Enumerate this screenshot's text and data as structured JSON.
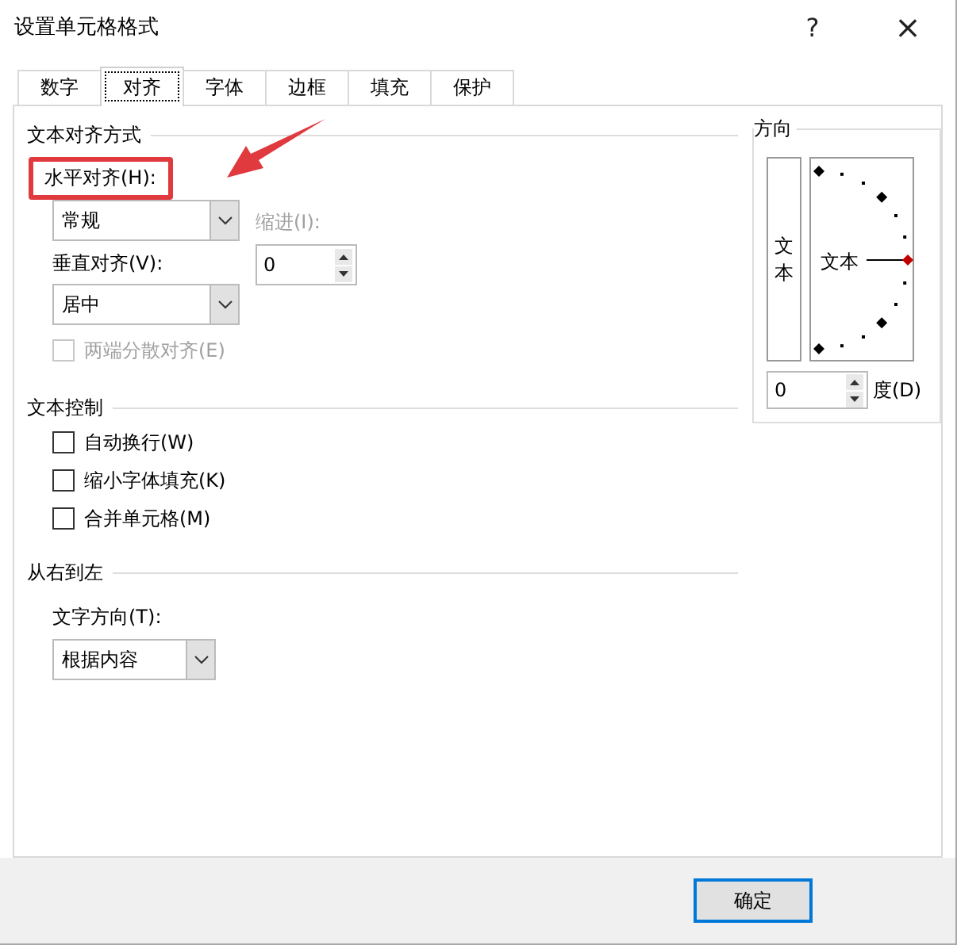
{
  "window": {
    "title": "设置单元格格式",
    "help": "?",
    "close": "×"
  },
  "tabs": [
    {
      "label": "数字",
      "selected": false
    },
    {
      "label": "对齐",
      "selected": true
    },
    {
      "label": "字体",
      "selected": false
    },
    {
      "label": "边框",
      "selected": false
    },
    {
      "label": "填充",
      "selected": false
    },
    {
      "label": "保护",
      "selected": false
    }
  ],
  "alignment": {
    "title": "文本对齐方式",
    "horizontal": {
      "label": "水平对齐(H):",
      "value": "常规",
      "highlighted": true
    },
    "indent": {
      "label": "缩进(I):",
      "value": "0",
      "disabled": true
    },
    "vertical": {
      "label": "垂直对齐(V):",
      "value": "居中"
    },
    "distributed": {
      "label": "两端分散对齐(E)",
      "checked": false,
      "disabled": true
    }
  },
  "text_control": {
    "title": "文本控制",
    "options": [
      {
        "label": "自动换行(W)",
        "checked": false,
        "disabled": false
      },
      {
        "label": "缩小字体填充(K)",
        "checked": false,
        "disabled": false
      },
      {
        "label": "合并单元格(M)",
        "checked": false,
        "disabled": false
      }
    ]
  },
  "rtl": {
    "title": "从右到左",
    "direction": {
      "label": "文字方向(T):",
      "value": "根据内容"
    }
  },
  "orientation": {
    "title": "方向",
    "vertical_text": "文本",
    "dial_text": "文本",
    "degrees": {
      "value": "0",
      "label": "度(D)"
    }
  },
  "buttons": [
    {
      "label": "确定",
      "default": true
    }
  ]
}
